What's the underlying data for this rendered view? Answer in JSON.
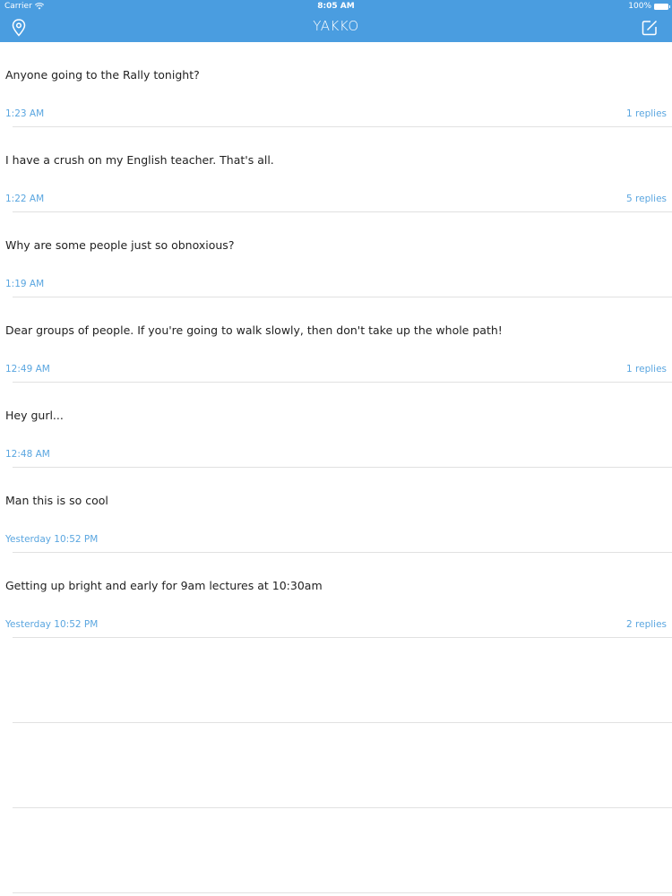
{
  "status_bar": {
    "carrier": "Carrier",
    "time": "8:05 AM",
    "battery": "100%"
  },
  "nav": {
    "title": "YAKKO",
    "left_icon": "location-pin-icon",
    "right_icon": "compose-icon"
  },
  "colors": {
    "accent": "#4a9de0",
    "link": "#5aa6e0",
    "text": "#222222",
    "divider": "#e1e1e1"
  },
  "posts": [
    {
      "text": "Anyone going to the Rally tonight?",
      "time": "1:23 AM",
      "replies": "1 replies"
    },
    {
      "text": "I have a crush on my English teacher. That's all.",
      "time": "1:22 AM",
      "replies": "5 replies"
    },
    {
      "text": "Why are some people just so obnoxious?",
      "time": "1:19 AM",
      "replies": ""
    },
    {
      "text": "Dear groups of people. If you're going to walk slowly, then don't take up the whole path!",
      "time": "12:49 AM",
      "replies": "1 replies"
    },
    {
      "text": "Hey gurl...",
      "time": "12:48 AM",
      "replies": ""
    },
    {
      "text": "Man this is so cool",
      "time": "Yesterday 10:52 PM",
      "replies": ""
    },
    {
      "text": "Getting up bright and early for 9am lectures at 10:30am",
      "time": "Yesterday 10:52 PM",
      "replies": "2 replies"
    }
  ]
}
